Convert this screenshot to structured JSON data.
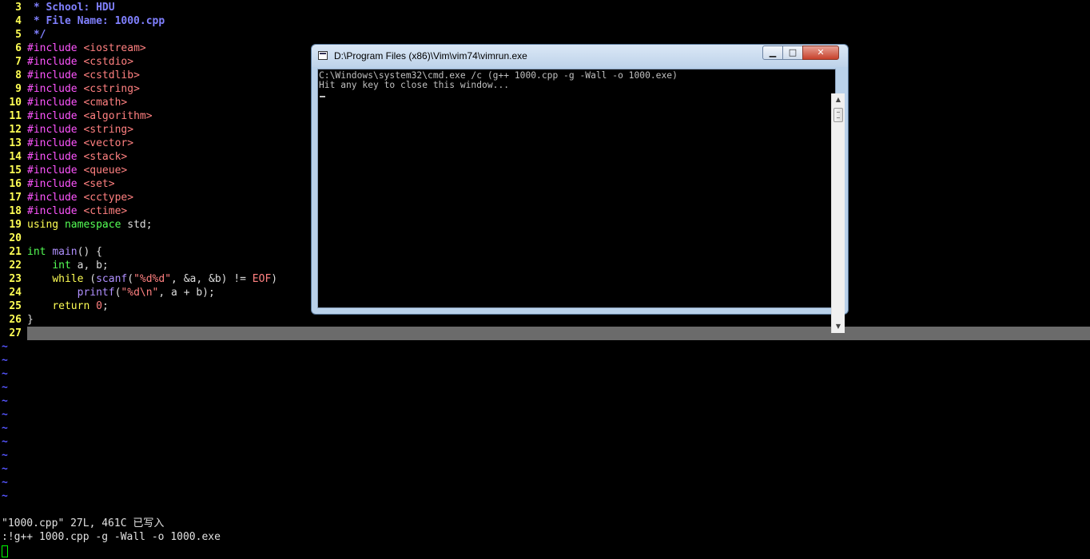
{
  "editor": {
    "lines": [
      {
        "n": "3",
        "segs": [
          {
            "c": "cm",
            "t": " * School: HDU"
          }
        ]
      },
      {
        "n": "4",
        "segs": [
          {
            "c": "cm",
            "t": " * File Name: 1000.cpp"
          }
        ]
      },
      {
        "n": "5",
        "segs": [
          {
            "c": "cm",
            "t": " */"
          }
        ]
      },
      {
        "n": "6",
        "segs": [
          {
            "c": "kw-pre",
            "t": "#include "
          },
          {
            "c": "str",
            "t": "<iostream>"
          }
        ]
      },
      {
        "n": "7",
        "segs": [
          {
            "c": "kw-pre",
            "t": "#include "
          },
          {
            "c": "str",
            "t": "<cstdio>"
          }
        ]
      },
      {
        "n": "8",
        "segs": [
          {
            "c": "kw-pre",
            "t": "#include "
          },
          {
            "c": "str",
            "t": "<cstdlib>"
          }
        ]
      },
      {
        "n": "9",
        "segs": [
          {
            "c": "kw-pre",
            "t": "#include "
          },
          {
            "c": "str",
            "t": "<cstring>"
          }
        ]
      },
      {
        "n": "10",
        "segs": [
          {
            "c": "kw-pre",
            "t": "#include "
          },
          {
            "c": "str",
            "t": "<cmath>"
          }
        ]
      },
      {
        "n": "11",
        "segs": [
          {
            "c": "kw-pre",
            "t": "#include "
          },
          {
            "c": "str",
            "t": "<algorithm>"
          }
        ]
      },
      {
        "n": "12",
        "segs": [
          {
            "c": "kw-pre",
            "t": "#include "
          },
          {
            "c": "str",
            "t": "<string>"
          }
        ]
      },
      {
        "n": "13",
        "segs": [
          {
            "c": "kw-pre",
            "t": "#include "
          },
          {
            "c": "str",
            "t": "<vector>"
          }
        ]
      },
      {
        "n": "14",
        "segs": [
          {
            "c": "kw-pre",
            "t": "#include "
          },
          {
            "c": "str",
            "t": "<stack>"
          }
        ]
      },
      {
        "n": "15",
        "segs": [
          {
            "c": "kw-pre",
            "t": "#include "
          },
          {
            "c": "str",
            "t": "<queue>"
          }
        ]
      },
      {
        "n": "16",
        "segs": [
          {
            "c": "kw-pre",
            "t": "#include "
          },
          {
            "c": "str",
            "t": "<set>"
          }
        ]
      },
      {
        "n": "17",
        "segs": [
          {
            "c": "kw-pre",
            "t": "#include "
          },
          {
            "c": "str",
            "t": "<cctype>"
          }
        ]
      },
      {
        "n": "18",
        "segs": [
          {
            "c": "kw-pre",
            "t": "#include "
          },
          {
            "c": "str",
            "t": "<ctime>"
          }
        ]
      },
      {
        "n": "19",
        "segs": [
          {
            "c": "kw",
            "t": "using"
          },
          {
            "c": "id",
            "t": " "
          },
          {
            "c": "kw-type",
            "t": "namespace"
          },
          {
            "c": "id",
            "t": " std;"
          }
        ]
      },
      {
        "n": "20",
        "segs": []
      },
      {
        "n": "21",
        "segs": [
          {
            "c": "kw-type",
            "t": "int"
          },
          {
            "c": "id",
            "t": " "
          },
          {
            "c": "fn",
            "t": "main"
          },
          {
            "c": "id",
            "t": "() {"
          }
        ]
      },
      {
        "n": "22",
        "segs": [
          {
            "c": "id",
            "t": "    "
          },
          {
            "c": "kw-type",
            "t": "int"
          },
          {
            "c": "id",
            "t": " a, b;"
          }
        ]
      },
      {
        "n": "23",
        "segs": [
          {
            "c": "id",
            "t": "    "
          },
          {
            "c": "kw",
            "t": "while"
          },
          {
            "c": "id",
            "t": " ("
          },
          {
            "c": "fn",
            "t": "scanf"
          },
          {
            "c": "id",
            "t": "("
          },
          {
            "c": "str",
            "t": "\"%d%d\""
          },
          {
            "c": "id",
            "t": ", &a, &b) != "
          },
          {
            "c": "str",
            "t": "EOF"
          },
          {
            "c": "id",
            "t": ")"
          }
        ]
      },
      {
        "n": "24",
        "segs": [
          {
            "c": "id",
            "t": "        "
          },
          {
            "c": "fn",
            "t": "printf"
          },
          {
            "c": "id",
            "t": "("
          },
          {
            "c": "str",
            "t": "\"%d\\n\""
          },
          {
            "c": "id",
            "t": ", a + b);"
          }
        ]
      },
      {
        "n": "25",
        "segs": [
          {
            "c": "id",
            "t": "    "
          },
          {
            "c": "kw",
            "t": "return"
          },
          {
            "c": "id",
            "t": " "
          },
          {
            "c": "num",
            "t": "0"
          },
          {
            "c": "id",
            "t": ";"
          }
        ]
      },
      {
        "n": "26",
        "segs": [
          {
            "c": "id",
            "t": "}"
          }
        ]
      },
      {
        "n": "27",
        "segs": []
      }
    ],
    "tilde_char": "~",
    "tilde_count": 12,
    "status_message": "\"1000.cpp\" 27L, 461C 已写入",
    "command_line": ":!g++ 1000.cpp -g -Wall -o 1000.exe"
  },
  "console": {
    "title": "D:\\Program Files (x86)\\Vim\\vim74\\vimrun.exe",
    "minimize_glyph": "▁",
    "maximize_glyph": "□",
    "close_glyph": "✕",
    "lines": [
      "C:\\Windows\\system32\\cmd.exe /c (g++ 1000.cpp -g -Wall -o 1000.exe)",
      "Hit any key to close this window..."
    ],
    "scroll_up_glyph": "▲",
    "scroll_down_glyph": "▼"
  },
  "colors": {
    "line_number": "#ffff55",
    "preproc": "#ff55ff",
    "string": "#ff8080",
    "comment": "#8080ff",
    "tilde": "#5555ff",
    "cursorline": "#6b6b6b",
    "cursor": "#00ff00"
  },
  "icons": {
    "console_app_icon": "console-window-icon",
    "minimize": "minimize-icon",
    "maximize": "maximize-icon",
    "close": "close-icon"
  }
}
